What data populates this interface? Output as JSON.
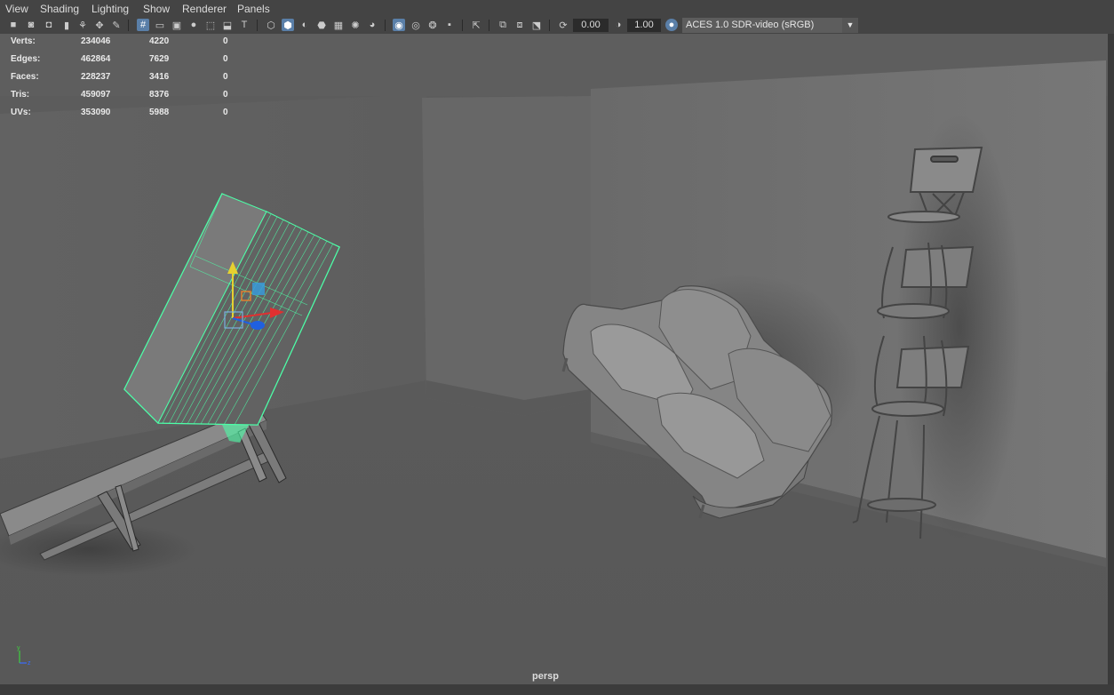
{
  "menu": [
    "View",
    "Shading",
    "Lighting",
    "Show",
    "Renderer",
    "Panels"
  ],
  "toolbar": {
    "exposure_value": "0.00",
    "gamma_value": "1.00",
    "colorspace_label": "ACES 1.0 SDR-video (sRGB)"
  },
  "hud": {
    "rows": [
      {
        "label": "Verts:",
        "total": "234046",
        "selected": "4220",
        "extra": "0"
      },
      {
        "label": "Edges:",
        "total": "462864",
        "selected": "7629",
        "extra": "0"
      },
      {
        "label": "Faces:",
        "total": "228237",
        "selected": "3416",
        "extra": "0"
      },
      {
        "label": "Tris:",
        "total": "459097",
        "selected": "8376",
        "extra": "0"
      },
      {
        "label": "UVs:",
        "total": "353090",
        "selected": "5988",
        "extra": "0"
      }
    ]
  },
  "camera_name": "persp",
  "axis": {
    "y": "y",
    "z": "z"
  },
  "colors": {
    "selection": "#4dffa8",
    "active_icon": "#5a7fa8",
    "gizmo_x": "#e03030",
    "gizmo_y": "#e6d030",
    "gizmo_z": "#2060e0"
  }
}
